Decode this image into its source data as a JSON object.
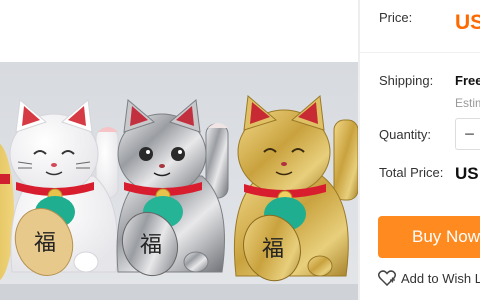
{
  "product": {
    "image_alt": "maneki-neko-photo"
  },
  "price": {
    "label": "Price:",
    "value": "US"
  },
  "shipping": {
    "label": "Shipping:",
    "value": "Free",
    "estimate": "Estim"
  },
  "quantity": {
    "label": "Quantity:",
    "minus_symbol": "−"
  },
  "total": {
    "label": "Total Price:",
    "value": "US"
  },
  "actions": {
    "buy_now": "Buy Now",
    "wish_list": "Add to Wish L"
  },
  "colors": {
    "accent": "#ff6a00",
    "buy_button": "#ff8a1f"
  }
}
